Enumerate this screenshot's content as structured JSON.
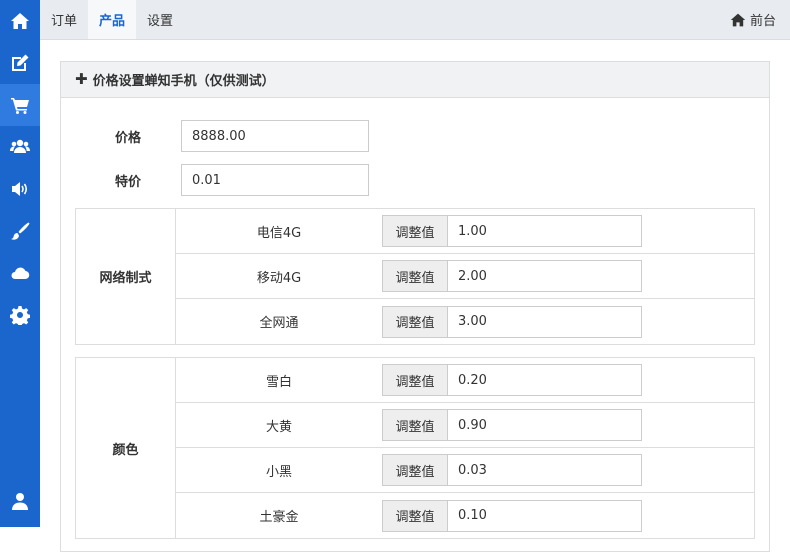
{
  "sidebar": {
    "items": [
      {
        "icon": "home-icon"
      },
      {
        "icon": "edit-icon"
      },
      {
        "icon": "shopping-cart-icon",
        "active": true
      },
      {
        "icon": "users-icon"
      },
      {
        "icon": "volume-icon"
      },
      {
        "icon": "brush-icon"
      },
      {
        "icon": "cloud-icon"
      },
      {
        "icon": "gear-icon"
      }
    ],
    "bottom_icon": "user-icon"
  },
  "topbar": {
    "tabs": [
      {
        "label": "订单"
      },
      {
        "label": "产品",
        "active": true
      },
      {
        "label": "设置"
      }
    ],
    "front_label": "前台"
  },
  "panel": {
    "title": "价格设置蝉知手机（仅供测试）",
    "price_label": "价格",
    "price_value": "8888.00",
    "special_label": "特价",
    "special_value": "0.01",
    "adjust_label": "调整值",
    "groups": [
      {
        "label": "网络制式",
        "options": [
          {
            "name": "电信4G",
            "value": "1.00"
          },
          {
            "name": "移动4G",
            "value": "2.00"
          },
          {
            "name": "全网通",
            "value": "3.00"
          }
        ]
      },
      {
        "label": "颜色",
        "options": [
          {
            "name": "雪白",
            "value": "0.20"
          },
          {
            "name": "大黄",
            "value": "0.90"
          },
          {
            "name": "小黑",
            "value": "0.03"
          },
          {
            "name": "土豪金",
            "value": "0.10"
          }
        ]
      }
    ]
  },
  "colors": {
    "sidebar_bg": "#1a66cc",
    "active_tab_text": "#1a66cc"
  }
}
